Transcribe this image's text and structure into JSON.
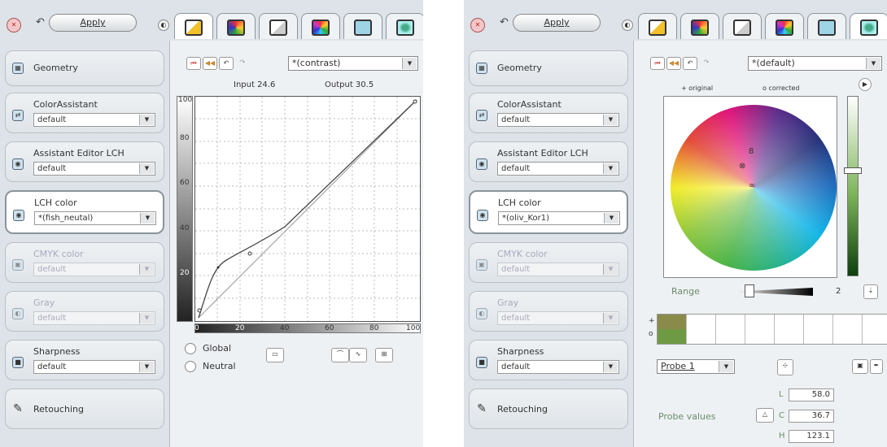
{
  "common": {
    "apply_label": "Apply",
    "close_icon": "close-icon",
    "undo_icon": "undo-icon"
  },
  "left_panel": {
    "sidebar": [
      {
        "label": "Geometry",
        "icon": "geometry-icon",
        "state": "normal"
      },
      {
        "label": "ColorAssistant",
        "value": "default",
        "icon": "colorassistant-icon",
        "state": "normal"
      },
      {
        "label": "Assistant Editor LCH",
        "value": "default",
        "icon": "lch-editor-icon",
        "state": "normal"
      },
      {
        "label": "LCH color",
        "value": "*(fish_neutal)",
        "icon": "lch-color-icon",
        "state": "active"
      },
      {
        "label": "CMYK color",
        "value": "default",
        "icon": "cmyk-icon",
        "state": "disabled"
      },
      {
        "label": "Gray",
        "value": "default",
        "icon": "gray-icon",
        "state": "disabled"
      },
      {
        "label": "Sharpness",
        "value": "default",
        "icon": "sharpness-icon",
        "state": "normal"
      },
      {
        "label": "Retouching",
        "icon": "retouching-icon",
        "state": "normal"
      }
    ],
    "preset": "*(contrast)",
    "input_label": "Input 24.6",
    "output_label": "Output 30.5",
    "y_ticks": [
      "100",
      "80",
      "60",
      "40",
      "20"
    ],
    "x_ticks": [
      "0",
      "20",
      "40",
      "60",
      "80",
      "100"
    ],
    "radio_global": "Global",
    "radio_neutral": "Neutral"
  },
  "right_panel": {
    "sidebar": [
      {
        "label": "Geometry",
        "icon": "geometry-icon",
        "state": "normal"
      },
      {
        "label": "ColorAssistant",
        "value": "default",
        "icon": "colorassistant-icon",
        "state": "normal"
      },
      {
        "label": "Assistant Editor LCH",
        "value": "default",
        "icon": "lch-editor-icon",
        "state": "normal"
      },
      {
        "label": "LCH color",
        "value": "*(oliv_Kor1)",
        "icon": "lch-color-icon",
        "state": "active"
      },
      {
        "label": "CMYK color",
        "value": "default",
        "icon": "cmyk-icon",
        "state": "disabled"
      },
      {
        "label": "Gray",
        "value": "default",
        "icon": "gray-icon",
        "state": "disabled"
      },
      {
        "label": "Sharpness",
        "value": "default",
        "icon": "sharpness-icon",
        "state": "normal"
      },
      {
        "label": "Retouching",
        "icon": "retouching-icon",
        "state": "normal"
      }
    ],
    "preset": "*(default)",
    "legend_original": "+ original",
    "legend_corrected": "o corrected",
    "range_label": "Range",
    "range_value": "2",
    "row_plus": "+",
    "row_o": "o",
    "probe_select": "Probe 1",
    "probe_values_label": "Probe values",
    "l_label": "L",
    "l_value": "58.0",
    "c_label": "C",
    "c_value": "36.7",
    "h_label": "H",
    "h_value": "123.1",
    "swatch_colors": [
      "#8a8a4a",
      "#6f9a44"
    ]
  }
}
